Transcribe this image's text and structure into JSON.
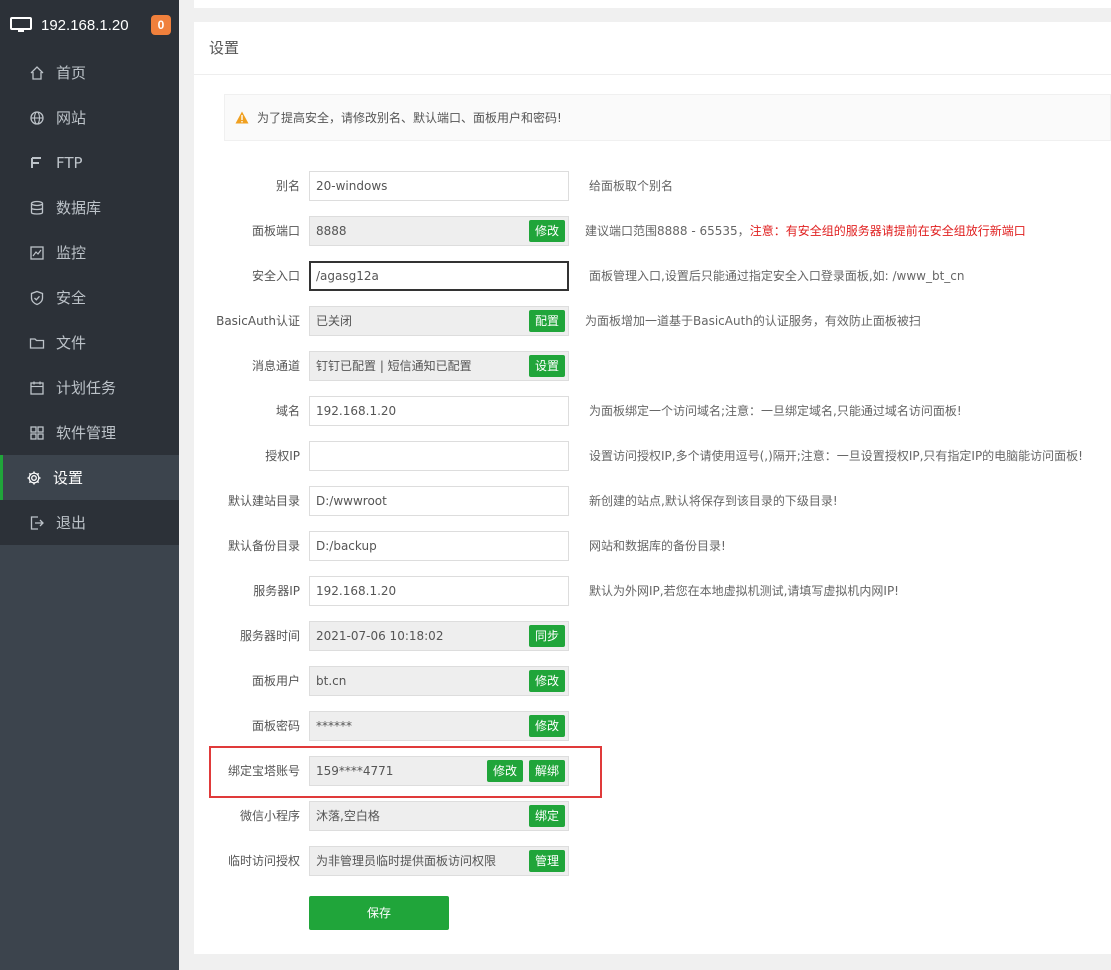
{
  "header": {
    "host": "192.168.1.20",
    "badge": "0"
  },
  "menu": [
    {
      "label": "首页",
      "icon": "home-icon"
    },
    {
      "label": "网站",
      "icon": "globe-icon"
    },
    {
      "label": "FTP",
      "icon": "ftp-icon"
    },
    {
      "label": "数据库",
      "icon": "database-icon"
    },
    {
      "label": "监控",
      "icon": "monitor-icon"
    },
    {
      "label": "安全",
      "icon": "shield-icon"
    },
    {
      "label": "文件",
      "icon": "folder-icon"
    },
    {
      "label": "计划任务",
      "icon": "calendar-icon"
    },
    {
      "label": "软件管理",
      "icon": "apps-icon"
    },
    {
      "label": "设置",
      "icon": "gear-icon",
      "active": true
    },
    {
      "label": "退出",
      "icon": "logout-icon"
    }
  ],
  "page": {
    "title": "设置",
    "alert": "为了提高安全，请修改别名、默认端口、面板用户和密码!"
  },
  "settings": {
    "alias": {
      "label": "别名",
      "value": "20-windows",
      "help": "给面板取个别名"
    },
    "port": {
      "label": "面板端口",
      "value": "8888",
      "button": "修改",
      "help": "建议端口范围8888 - 65535，",
      "help_warn": "注意：有安全组的服务器请提前在安全组放行新端口"
    },
    "entry": {
      "label": "安全入口",
      "value": "/agasg12a",
      "help": "面板管理入口,设置后只能通过指定安全入口登录面板,如: /www_bt_cn"
    },
    "basicauth": {
      "label": "BasicAuth认证",
      "value": "已关闭",
      "button": "配置",
      "help": "为面板增加一道基于BasicAuth的认证服务，有效防止面板被扫"
    },
    "message": {
      "label": "消息通道",
      "value": "钉钉已配置 | 短信通知已配置",
      "button": "设置"
    },
    "domain": {
      "label": "域名",
      "value": "192.168.1.20",
      "help": "为面板绑定一个访问域名;注意：一旦绑定域名,只能通过域名访问面板!"
    },
    "authip": {
      "label": "授权IP",
      "value": "",
      "help": "设置访问授权IP,多个请使用逗号(,)隔开;注意：一旦设置授权IP,只有指定IP的电脑能访问面板!"
    },
    "sitedir": {
      "label": "默认建站目录",
      "value": "D:/wwwroot",
      "help": "新创建的站点,默认将保存到该目录的下级目录!"
    },
    "backupdir": {
      "label": "默认备份目录",
      "value": "D:/backup",
      "help": "网站和数据库的备份目录!"
    },
    "serverip": {
      "label": "服务器IP",
      "value": "192.168.1.20",
      "help": "默认为外网IP,若您在本地虚拟机测试,请填写虚拟机内网IP!"
    },
    "servertime": {
      "label": "服务器时间",
      "value": "2021-07-06 10:18:02",
      "button": "同步"
    },
    "user": {
      "label": "面板用户",
      "value": "bt.cn",
      "button": "修改"
    },
    "password": {
      "label": "面板密码",
      "value": "******",
      "button": "修改"
    },
    "btaccount": {
      "label": "绑定宝塔账号",
      "value": "159****4771",
      "button": "修改",
      "button2": "解绑"
    },
    "wechat": {
      "label": "微信小程序",
      "value": "沐落,空白格",
      "button": "绑定"
    },
    "tempauth": {
      "label": "临时访问授权",
      "value": "为非管理员临时提供面板访问权限",
      "button": "管理"
    }
  },
  "save_label": "保存",
  "colors": {
    "accent": "#20a53a",
    "sidebar": "#3c444d",
    "warn": "#e02020",
    "badge": "#f0803c"
  }
}
